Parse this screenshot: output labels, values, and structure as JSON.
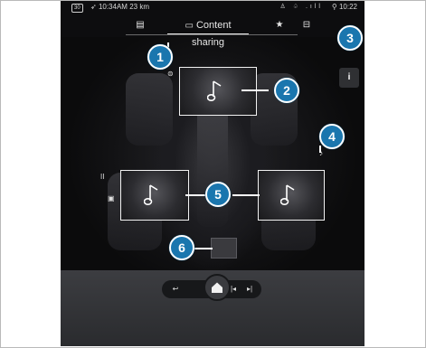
{
  "statusbar": {
    "badge": "30",
    "time_left": "10:34AM",
    "distance": "23 km",
    "signal_icons": "♙ ♤ .ıll",
    "time_right": "10:22"
  },
  "tabs": {
    "chat_icon": "▤",
    "active_icon": "▭",
    "active_label": "Content sharing",
    "star_icon": "★",
    "car_icon": "⊟"
  },
  "callouts": {
    "c1": "1",
    "c2": "2",
    "c3": "3",
    "c4": "4",
    "c5": "5",
    "c6": "6"
  },
  "info_icon": "i",
  "icons": {
    "top_seat": "⊜",
    "left_pause": "II",
    "left_screen": "▣",
    "right_seat": "♪"
  },
  "nav": {
    "back": "↩",
    "prev": "|◂",
    "next": "▸|"
  }
}
